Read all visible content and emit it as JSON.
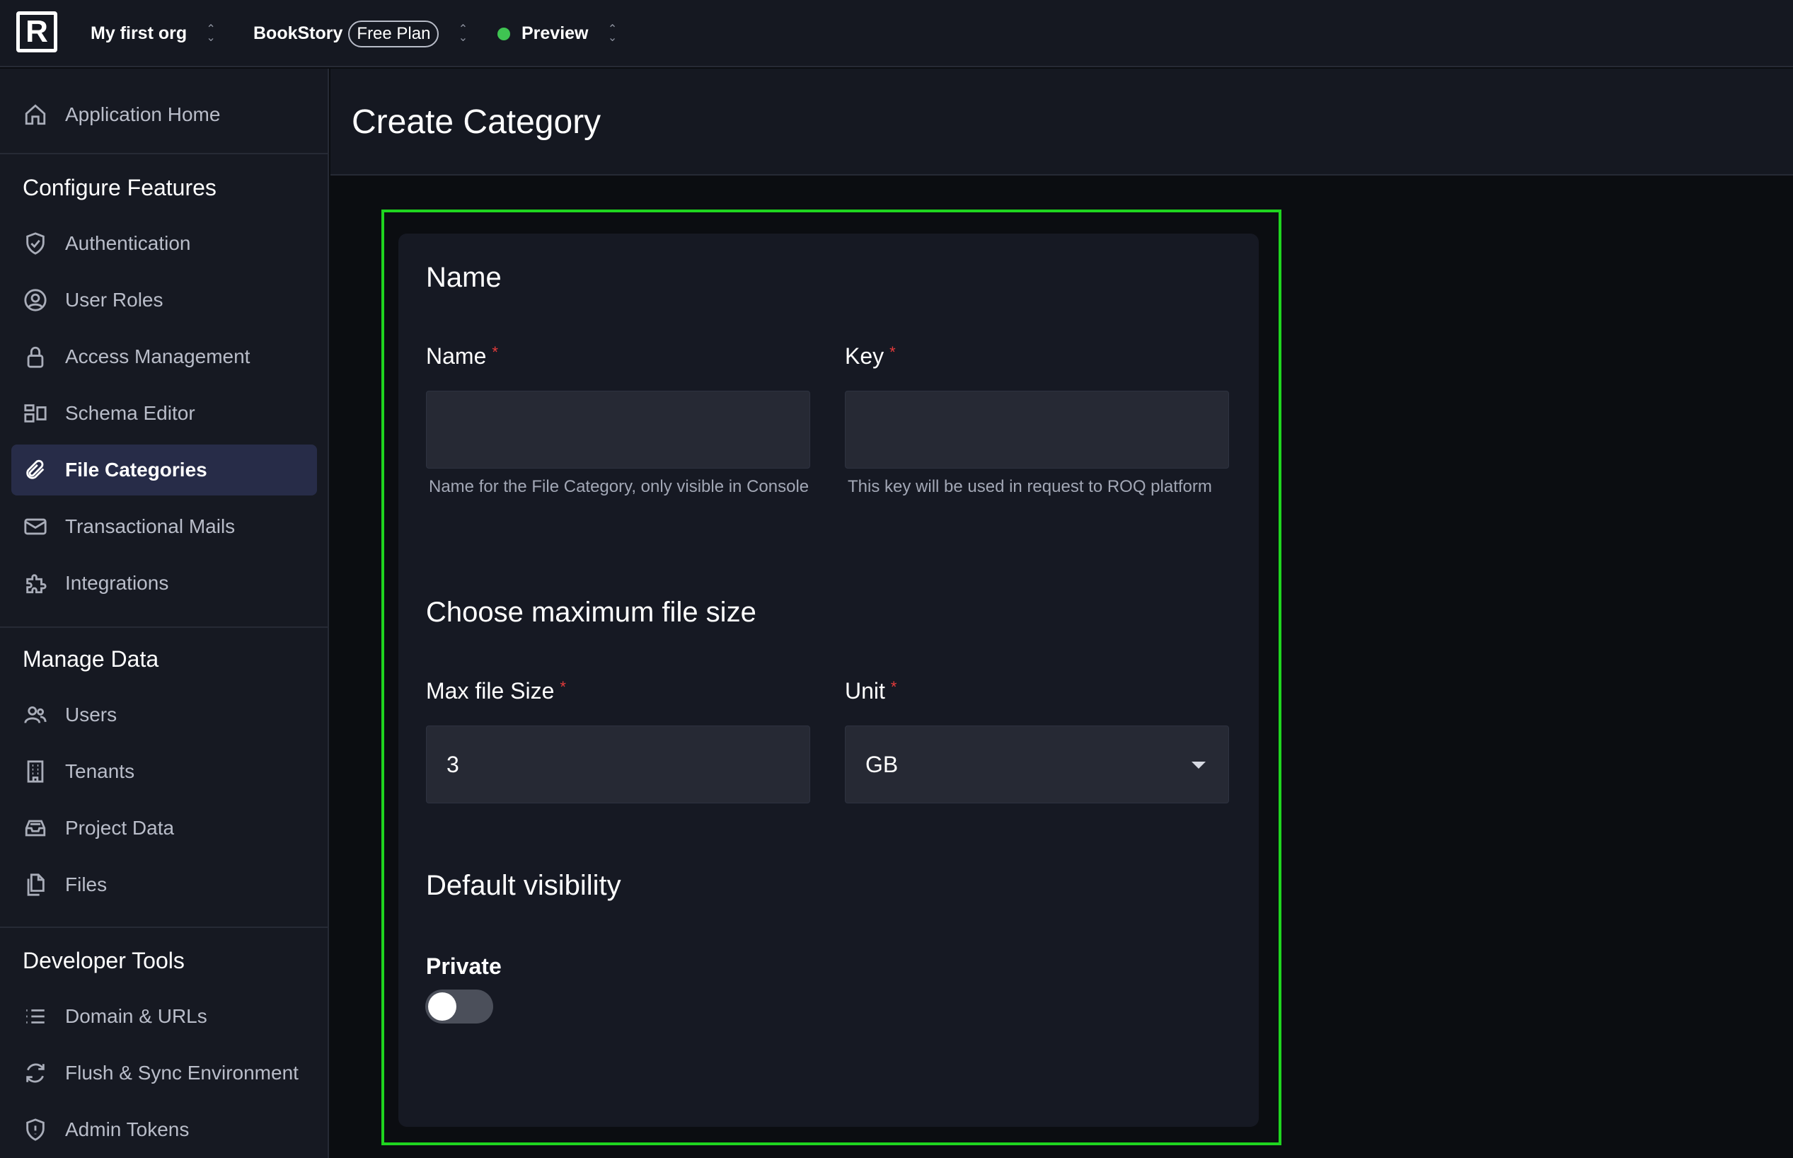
{
  "topbar": {
    "logo_letter": "R",
    "org": "My first org",
    "project": "BookStory",
    "plan": "Free Plan",
    "environment": "Preview",
    "environment_status_color": "#3fc452"
  },
  "sidebar": {
    "home": {
      "label": "Application Home",
      "icon": "home-icon"
    },
    "configure": {
      "title": "Configure Features",
      "items": [
        {
          "label": "Authentication",
          "icon": "shield-check-icon"
        },
        {
          "label": "User Roles",
          "icon": "user-circle-icon"
        },
        {
          "label": "Access Management",
          "icon": "lock-icon"
        },
        {
          "label": "Schema Editor",
          "icon": "schema-icon"
        },
        {
          "label": "File Categories",
          "icon": "paperclip-icon"
        },
        {
          "label": "Transactional Mails",
          "icon": "mail-icon"
        },
        {
          "label": "Integrations",
          "icon": "puzzle-icon"
        }
      ]
    },
    "manage": {
      "title": "Manage Data",
      "items": [
        {
          "label": "Users",
          "icon": "users-icon"
        },
        {
          "label": "Tenants",
          "icon": "building-icon"
        },
        {
          "label": "Project Data",
          "icon": "database-icon"
        },
        {
          "label": "Files",
          "icon": "files-icon"
        }
      ]
    },
    "developer": {
      "title": "Developer Tools",
      "items": [
        {
          "label": "Domain & URLs",
          "icon": "list-icon"
        },
        {
          "label": "Flush & Sync Environment",
          "icon": "sync-icon"
        },
        {
          "label": "Admin Tokens",
          "icon": "shield-alert-icon"
        }
      ]
    },
    "active_item": "File Categories",
    "active_color": "#272c48"
  },
  "page": {
    "title": "Create Category"
  },
  "form": {
    "name_section": {
      "heading": "Name",
      "name_field": {
        "label": "Name",
        "required_mark": "*",
        "value": "",
        "hint": "Name for the File Category, only visible in Console"
      },
      "key_field": {
        "label": "Key",
        "required_mark": "*",
        "value": "",
        "hint": "This key will be used in request to ROQ platform"
      }
    },
    "size_section": {
      "heading": "Choose maximum file size",
      "max_size_field": {
        "label": "Max file Size",
        "required_mark": "*",
        "value": "3"
      },
      "unit_field": {
        "label": "Unit",
        "required_mark": "*",
        "value": "GB"
      }
    },
    "visibility_section": {
      "heading": "Default visibility",
      "private_toggle": {
        "label": "Private",
        "checked": false
      }
    }
  },
  "highlight_color": "#1fd41f"
}
